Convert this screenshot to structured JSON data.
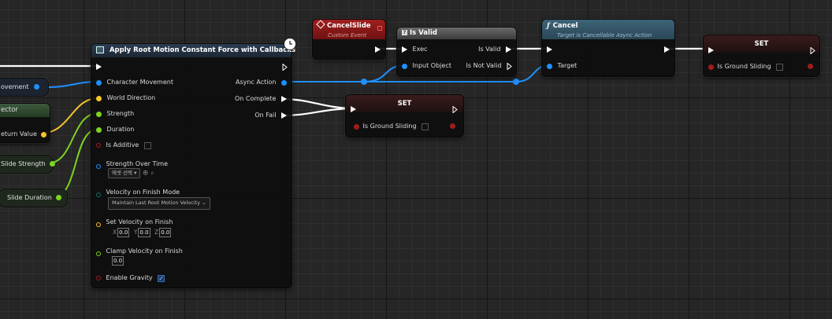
{
  "colors": {
    "exec": "#ffffff",
    "object": "#1e90ff",
    "vector": "#f5c52a",
    "float": "#7ed321",
    "bool": "#a01c1c",
    "event_header": "#8e1b1b",
    "function_header": "#365566",
    "set_header": "#3a2020",
    "apply_header": "#22303e"
  },
  "left_vars": {
    "movement_label": "ovement",
    "vector_title": "ector",
    "return_value_label": "eturn Value",
    "slide_strength_label": "Slide Strength",
    "slide_duration_label": "Slide Duration"
  },
  "apply_node": {
    "title": "Apply Root Motion Constant Force with Callbacks",
    "clock_icon": "clock-icon",
    "inputs": {
      "character_movement": "Character Movement",
      "world_direction": "World Direction",
      "strength": "Strength",
      "duration": "Duration",
      "is_additive": "Is Additive",
      "strength_over_time": "Strength Over Time",
      "strength_over_time_value": "에셋 선택",
      "velocity_on_finish_mode": "Velocity on Finish Mode",
      "velocity_on_finish_mode_value": "Maintain Last Root Motion Velocity",
      "set_velocity_on_finish": "Set Velocity on Finish",
      "x_label": "X",
      "y_label": "Y",
      "z_label": "Z",
      "x_value": "0.0",
      "y_value": "0.0",
      "z_value": "0.0",
      "clamp_velocity_on_finish": "Clamp Velocity on Finish",
      "clamp_value": "0.0",
      "enable_gravity": "Enable Gravity"
    },
    "outputs": {
      "async_action": "Async Action",
      "on_complete": "On Complete",
      "on_fail": "On Fail"
    }
  },
  "cancel_slide_node": {
    "title": "CancelSlide",
    "subtitle": "Custom Event"
  },
  "is_valid_node": {
    "title": "Is Valid",
    "exec": "Exec",
    "input_object": "Input Object",
    "is_valid": "Is Valid",
    "is_not_valid": "Is Not Valid"
  },
  "cancel_node": {
    "title": "Cancel",
    "subtitle": "Target is Cancellable Async Action",
    "target": "Target"
  },
  "set_node_right": {
    "title": "SET",
    "var": "Is Ground Sliding"
  },
  "set_node_mid": {
    "title": "SET",
    "var": "Is Ground Sliding"
  }
}
